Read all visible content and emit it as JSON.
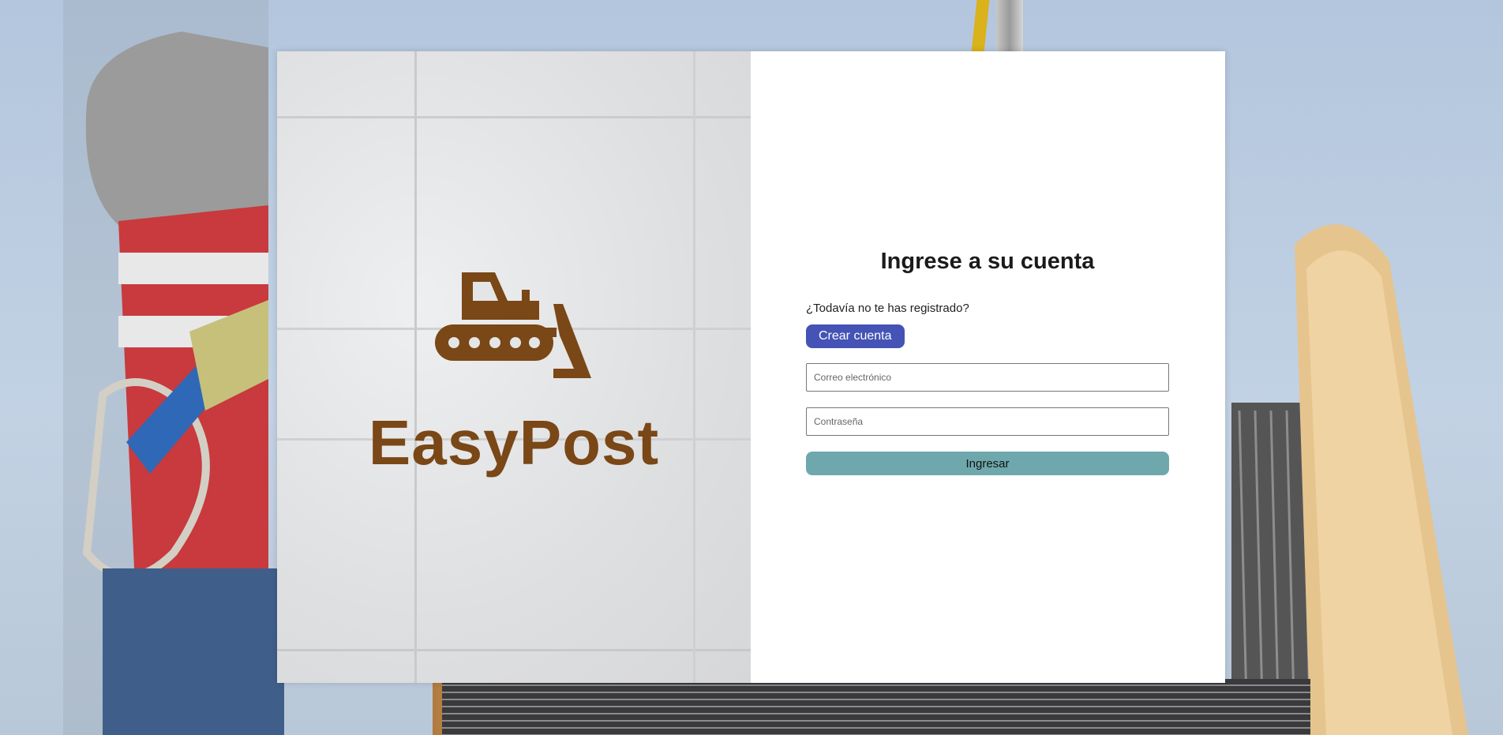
{
  "brand": {
    "name": "EasyPost",
    "icon": "bulldozer-icon",
    "color": "#7a4716"
  },
  "login": {
    "title": "Ingrese a su cuenta",
    "register_prompt": "¿Todavía no te has registrado?",
    "create_account_label": "Crear cuenta",
    "email_placeholder": "Correo electrónico",
    "email_value": "",
    "password_placeholder": "Contraseña",
    "password_value": "",
    "submit_label": "Ingresar"
  },
  "colors": {
    "create_account_bg": "#4453b5",
    "submit_bg": "#6ea8ac"
  }
}
